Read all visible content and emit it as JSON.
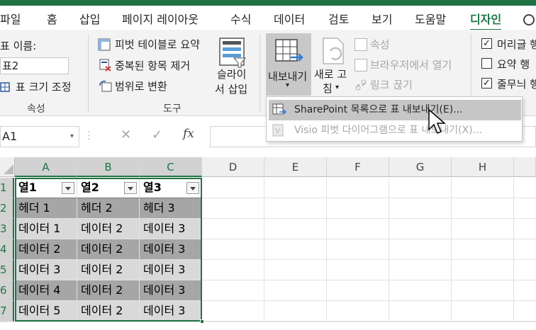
{
  "ribbon_tabs": [
    "파일",
    "홈",
    "삽입",
    "페이지 레이아웃",
    "수식",
    "데이터",
    "검토",
    "보기",
    "도움말",
    "디자인"
  ],
  "active_tab": "디자인",
  "properties": {
    "table_name_label": "표 이름:",
    "table_name_value": "표2",
    "resize_label": "표 크기 조정",
    "group_label": "속성"
  },
  "tools": {
    "pivot_label": "피벗 테이블로 요약",
    "remove_dup_label": "중복된 항목 제거",
    "convert_range_label": "범위로 변환",
    "slicer_label_1": "슬라이",
    "slicer_label_2": "서 삽입",
    "group_label": "도구"
  },
  "external": {
    "export_label": "내보내기",
    "refresh_label_1": "새로 고",
    "refresh_label_2": "침",
    "properties_label": "속성",
    "open_browser_label": "브라우저에서 열기",
    "unlink_label": "링크 끊기"
  },
  "style_options": {
    "header_row": {
      "label": "머리글 행",
      "checked": true
    },
    "total_row": {
      "label": "요약 행",
      "checked": false
    },
    "banded_rows": {
      "label": "줄무늬 행",
      "checked": true
    }
  },
  "export_menu": [
    {
      "label": "SharePoint 목록으로 표 내보내기(E)...",
      "highlighted": true,
      "enabled": true
    },
    {
      "label": "Visio 피벗 다이어그램으로 표 내보내기(X)...",
      "highlighted": false,
      "enabled": false
    }
  ],
  "formula_bar": {
    "cell_ref": "A1",
    "fx": "fx",
    "formula": ""
  },
  "columns": [
    "A",
    "B",
    "C",
    "D",
    "E",
    "F",
    "G",
    "H"
  ],
  "rows": [
    "1",
    "2",
    "3",
    "4",
    "5",
    "6",
    "7"
  ],
  "table": {
    "headers": [
      "열1",
      "열2",
      "열3"
    ],
    "body": [
      [
        "헤더 1",
        "헤더 2",
        "헤더 3"
      ],
      [
        "데이터 1",
        "데이터 2",
        "데이터 3"
      ],
      [
        "데이터 2",
        "데이터 2",
        "데이터 3"
      ],
      [
        "데이터 3",
        "데이터 2",
        "데이터 3"
      ],
      [
        "데이터 4",
        "데이터 2",
        "데이터 3"
      ],
      [
        "데이터 5",
        "데이터 2",
        "데이터 3"
      ]
    ]
  },
  "colors": {
    "accent": "#217346",
    "band_dark": "#a6a6a6",
    "band_light": "#d9d9d9"
  }
}
